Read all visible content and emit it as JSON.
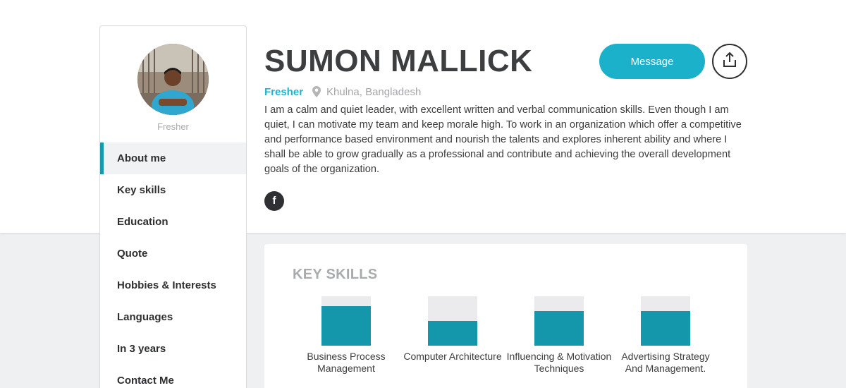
{
  "profile": {
    "name": "SUMON MALLICK",
    "role": "Fresher",
    "location": "Khulna, Bangladesh",
    "bio": "I am a calm and quiet leader, with excellent written and verbal communication skills. Even though I am quiet, I can motivate my team and keep morale high. To work in an organization which offer a competitive and performance based environment and nourish the talents and explores inherent ability and where I shall be able to grow gradually as a professional and contribute and achieving the overall development goals of the organization.",
    "facebook_label": "f"
  },
  "actions": {
    "message_label": "Message",
    "share_icon": "share-icon"
  },
  "sidebar": {
    "role": "Fresher",
    "items": [
      {
        "label": "About me",
        "active": true
      },
      {
        "label": "Key skills",
        "active": false
      },
      {
        "label": "Education",
        "active": false
      },
      {
        "label": "Quote",
        "active": false
      },
      {
        "label": "Hobbies & Interests",
        "active": false
      },
      {
        "label": "Languages",
        "active": false
      },
      {
        "label": "In 3 years",
        "active": false
      },
      {
        "label": "Contact Me",
        "active": false
      }
    ]
  },
  "skills": {
    "title": "KEY SKILLS",
    "items": [
      {
        "label": "Business Process Management",
        "level": 0.8
      },
      {
        "label": "Computer Architecture",
        "level": 0.5
      },
      {
        "label": "Influencing & Motivation Techniques",
        "level": 0.7
      },
      {
        "label": "Advertising Strategy And Management.",
        "level": 0.7
      }
    ]
  },
  "colors": {
    "accent": "#1bb1cb",
    "bar": "#1497aa",
    "dark": "#2f3033"
  }
}
